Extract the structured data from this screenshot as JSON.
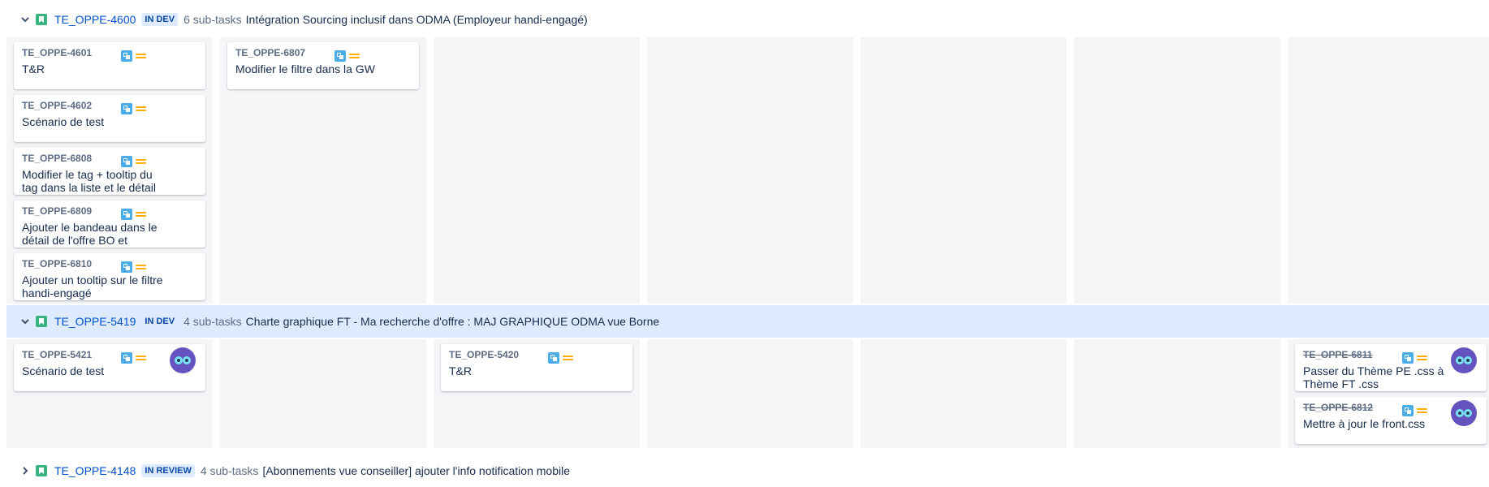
{
  "swimlanes": [
    {
      "key": "TE_OPPE-4600",
      "status": "IN DEV",
      "subtasks": "6 sub-tasks",
      "summary": "Intégration Sourcing inclusif dans ODMA (Employeur handi-engagé)",
      "columns": [
        [
          {
            "key": "TE_OPPE-4601",
            "summary": "T&R"
          },
          {
            "key": "TE_OPPE-4602",
            "summary": "Scénario de test"
          },
          {
            "key": "TE_OPPE-6808",
            "summary": "Modifier le tag + tooltip du tag dans la liste et le détail"
          },
          {
            "key": "TE_OPPE-6809",
            "summary": "Ajouter le bandeau dans le détail de l'offre BO et"
          },
          {
            "key": "TE_OPPE-6810",
            "summary": "Ajouter un tooltip sur le filtre handi-engagé"
          }
        ],
        [
          {
            "key": "TE_OPPE-6807",
            "summary": "Modifier le filtre dans la GW"
          }
        ],
        [],
        [],
        [],
        [],
        []
      ]
    },
    {
      "key": "TE_OPPE-5419",
      "status": "IN DEV",
      "subtasks": "4 sub-tasks",
      "summary": "Charte graphique FT - Ma recherche d'offre : MAJ GRAPHIQUE ODMA vue Borne",
      "columns": [
        [
          {
            "key": "TE_OPPE-5421",
            "summary": "Scénario de test",
            "avatar": true
          }
        ],
        [],
        [
          {
            "key": "TE_OPPE-5420",
            "summary": "T&R"
          }
        ],
        [],
        [],
        [],
        [
          {
            "key": "TE_OPPE-6811",
            "summary": "Passer du Thème PE .css à Thème FT .css",
            "avatar": true,
            "done": true
          },
          {
            "key": "TE_OPPE-6812",
            "summary": "Mettre à jour le front.css",
            "avatar": true,
            "done": true
          }
        ]
      ]
    },
    {
      "key": "TE_OPPE-4148",
      "status": "IN REVIEW",
      "subtasks": "4 sub-tasks",
      "summary": "[Abonnements vue conseiller] ajouter l'info notification mobile"
    }
  ],
  "icons": {
    "chevron": "chevron-down-icon",
    "story": "story-icon",
    "subtask": "subtask-icon",
    "priority": "priority-medium-icon"
  },
  "colors": {
    "link": "#0052cc",
    "lozenge_bg": "#deebff",
    "lozenge_text": "#0747a6",
    "story_green": "#36b37e",
    "subtask_blue": "#4bade8",
    "priority_orange": "#ffab00",
    "column_bg": "#f4f5f7",
    "highlight_bg": "#deebff",
    "avatar_bg": "#6554c0"
  }
}
